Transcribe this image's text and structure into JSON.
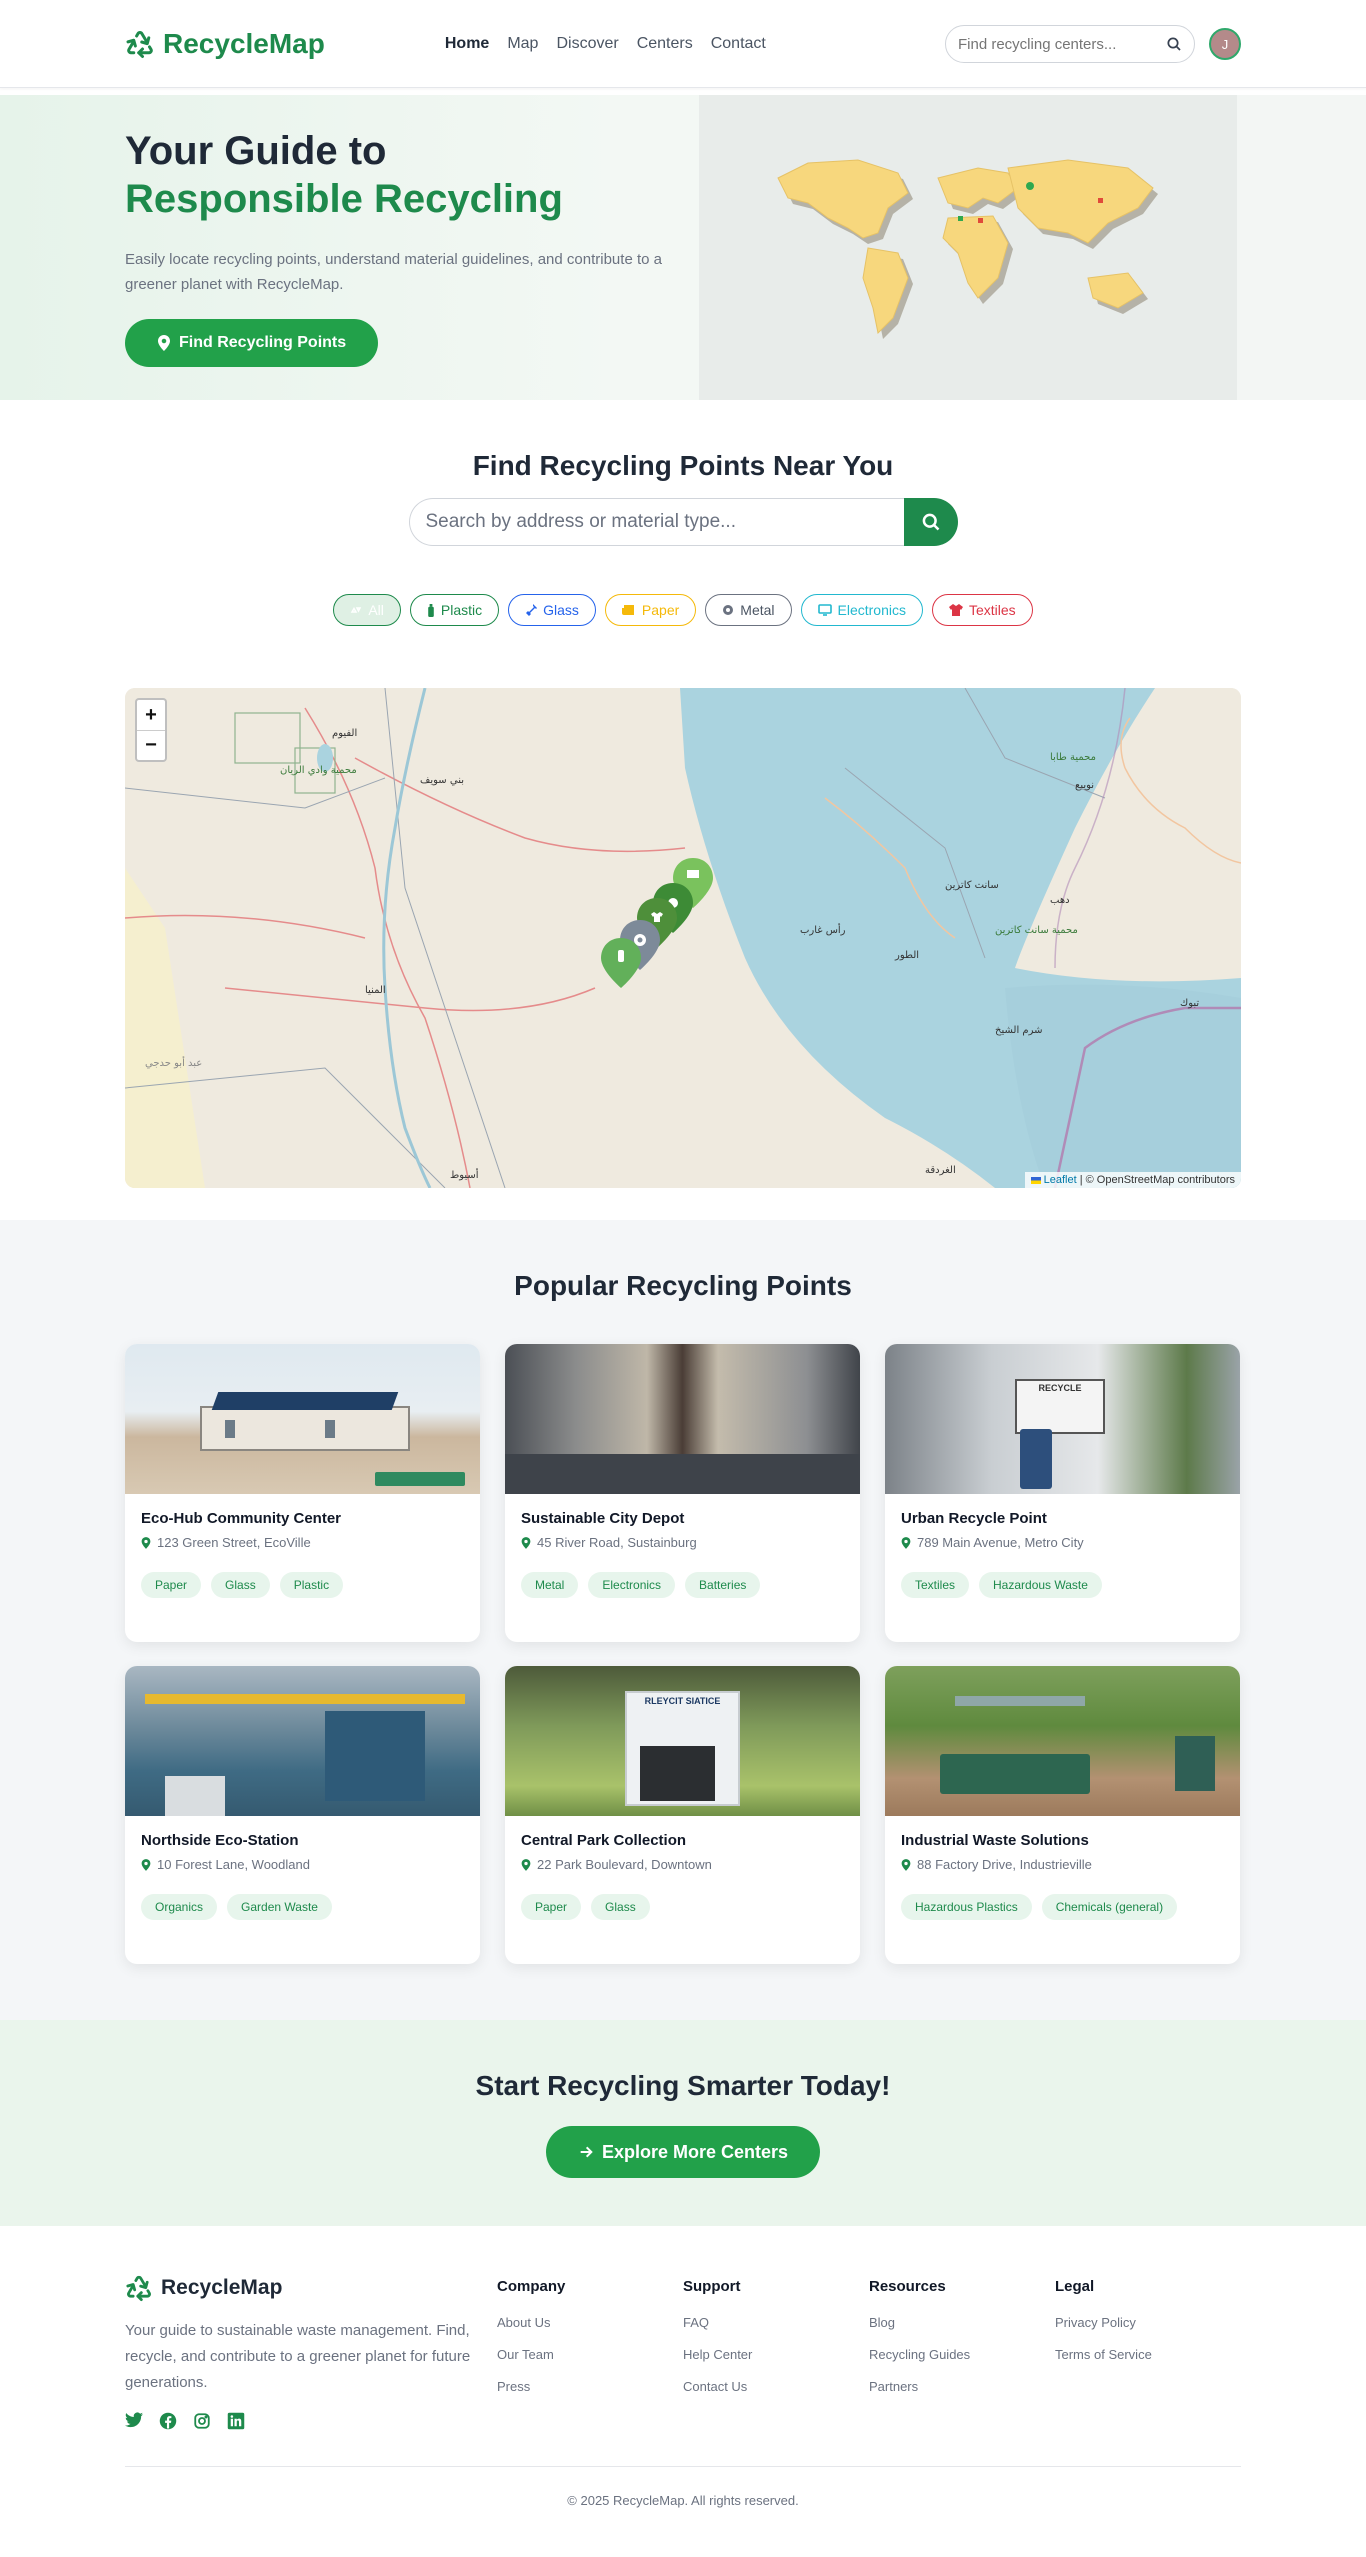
{
  "header": {
    "brand": "RecycleMap",
    "nav": [
      "Home",
      "Map",
      "Discover",
      "Centers",
      "Contact"
    ],
    "active_nav": "Home",
    "search_placeholder": "Find recycling centers...",
    "avatar_initial": "J"
  },
  "hero": {
    "title_line1": "Your Guide to",
    "title_line2": "Responsible Recycling",
    "description": "Easily locate recycling points, understand material guidelines, and contribute to a greener planet with RecycleMap.",
    "button": "Find Recycling Points"
  },
  "find": {
    "title": "Find Recycling Points Near You",
    "search_placeholder": "Search by address or material type...",
    "filters": [
      {
        "label": "All",
        "color": "#1e8a4c",
        "active": true
      },
      {
        "label": "Plastic",
        "color": "#1e8a4c"
      },
      {
        "label": "Glass",
        "color": "#2563eb"
      },
      {
        "label": "Paper",
        "color": "#f5b90a"
      },
      {
        "label": "Metal",
        "color": "#6b7280"
      },
      {
        "label": "Electronics",
        "color": "#22b8cf"
      },
      {
        "label": "Textiles",
        "color": "#dc3545"
      }
    ],
    "map_attribution_link": "Leaflet",
    "map_attribution": "| © OpenStreetMap contributors",
    "map_labels": [
      "محمية وادي الريان",
      "الفيوم",
      "بني سويف",
      "المنيا",
      "أسيوط",
      "محمية سانت كاترين",
      "سانت كاترين",
      "الطور",
      "شرم الشيخ",
      "رأس غارب",
      "الغردقة",
      "دهب",
      "نويبع",
      "تبوك",
      "محمية طابا",
      "عبد أبو حدجي"
    ]
  },
  "popular": {
    "title": "Popular Recycling Points",
    "cards": [
      {
        "name": "Eco-Hub Community Center",
        "address": "123 Green Street, EcoVille",
        "tags": [
          "Paper",
          "Glass",
          "Plastic"
        ]
      },
      {
        "name": "Sustainable City Depot",
        "address": "45 River Road, Sustainburg",
        "tags": [
          "Metal",
          "Electronics",
          "Batteries"
        ]
      },
      {
        "name": "Urban Recycle Point",
        "address": "789 Main Avenue, Metro City",
        "tags": [
          "Textiles",
          "Hazardous Waste"
        ],
        "photo_sign": "RECYCLE"
      },
      {
        "name": "Northside Eco-Station",
        "address": "10 Forest Lane, Woodland",
        "tags": [
          "Organics",
          "Garden Waste"
        ]
      },
      {
        "name": "Central Park Collection",
        "address": "22 Park Boulevard, Downtown",
        "tags": [
          "Paper",
          "Glass"
        ],
        "photo_sign": "RLEYCIT SIATICE"
      },
      {
        "name": "Industrial Waste Solutions",
        "address": "88 Factory Drive, Industrieville",
        "tags": [
          "Hazardous Plastics",
          "Chemicals (general)"
        ]
      }
    ]
  },
  "cta": {
    "title": "Start Recycling Smarter Today!",
    "button": "Explore More Centers"
  },
  "footer": {
    "brand": "RecycleMap",
    "description": "Your guide to sustainable waste management. Find, recycle, and contribute to a greener planet for future generations.",
    "columns": [
      {
        "title": "Company",
        "links": [
          "About Us",
          "Our Team",
          "Press"
        ]
      },
      {
        "title": "Support",
        "links": [
          "FAQ",
          "Help Center",
          "Contact Us"
        ]
      },
      {
        "title": "Resources",
        "links": [
          "Blog",
          "Recycling Guides",
          "Partners"
        ]
      },
      {
        "title": "Legal",
        "links": [
          "Privacy Policy",
          "Terms of Service"
        ]
      }
    ],
    "socials": [
      "twitter-icon",
      "facebook-icon",
      "instagram-icon",
      "linkedin-icon"
    ],
    "copyright": "© 2025 RecycleMap. All rights reserved."
  },
  "colors": {
    "brand_green": "#1e8a4c",
    "button_green": "#22a14a",
    "hero_bg": "#e6f3ea"
  }
}
